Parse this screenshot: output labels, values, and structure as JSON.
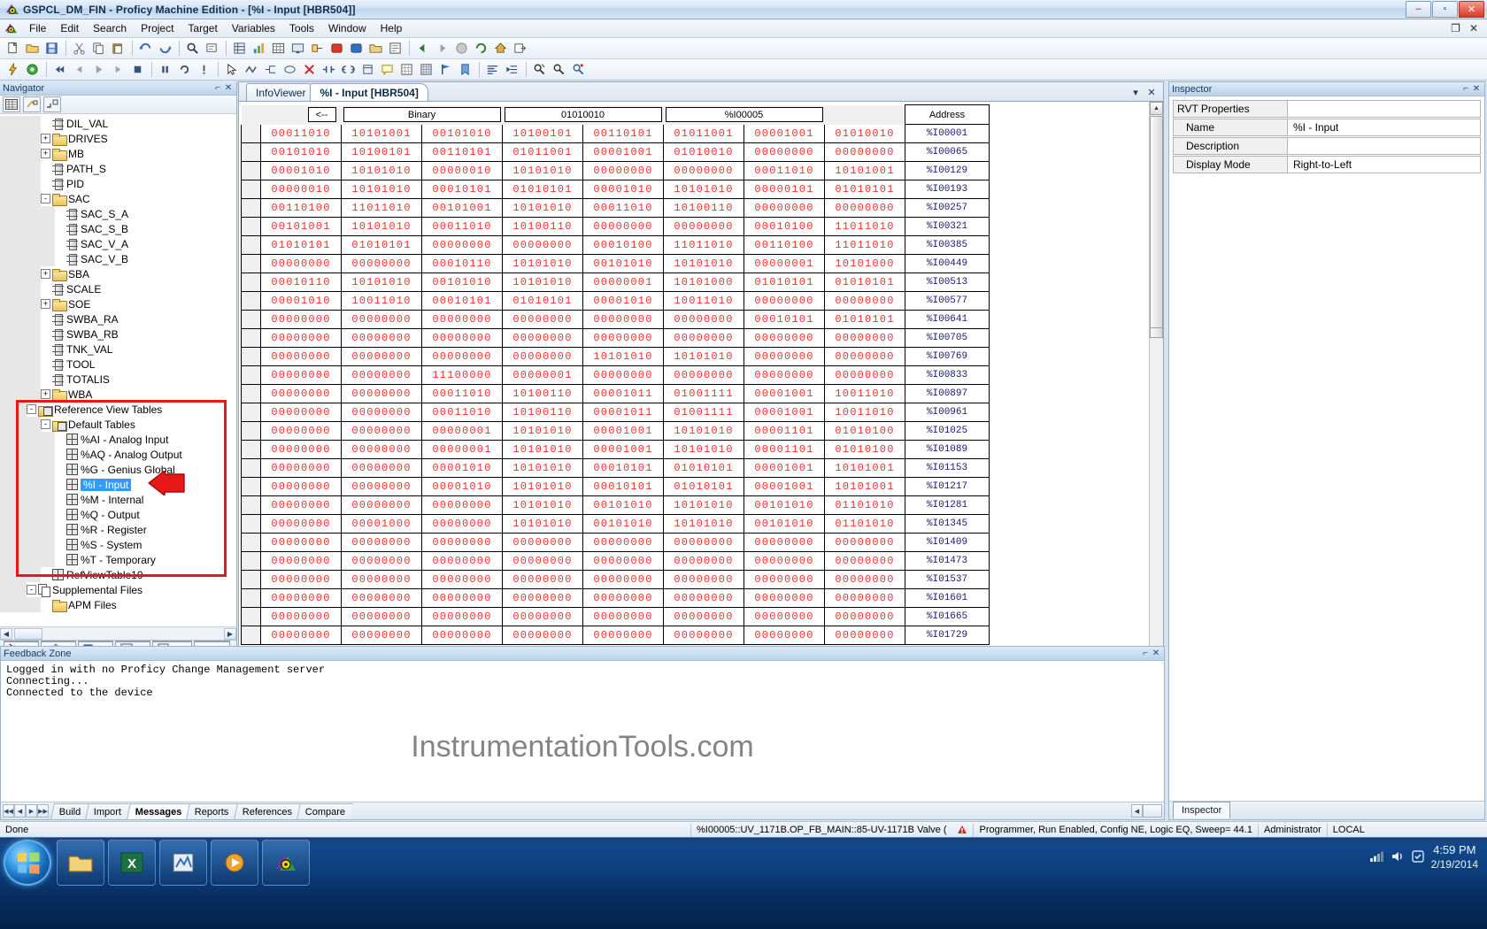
{
  "window": {
    "title": "GSPCL_DM_FIN - Proficy Machine Edition - [%I - Input [HBR504]]",
    "minimize": "–",
    "maximize": "▫",
    "close": "✕",
    "inner_restore": "❐",
    "inner_close": "✕"
  },
  "menu": [
    {
      "label": "File"
    },
    {
      "label": "Edit"
    },
    {
      "label": "Search"
    },
    {
      "label": "Project"
    },
    {
      "label": "Target"
    },
    {
      "label": "Variables"
    },
    {
      "label": "Tools"
    },
    {
      "label": "Window"
    },
    {
      "label": "Help"
    }
  ],
  "navigator": {
    "caption": "Navigator",
    "pin": "⌐",
    "close": "✕",
    "toolbar_icons": [
      "grid-view-icon",
      "expand-partial-icon",
      "collapse-icon"
    ],
    "tree": [
      {
        "indent": 3,
        "toggle": "",
        "icon": "block-icon",
        "label": "DIL_VAL"
      },
      {
        "indent": 3,
        "toggle": "+",
        "icon": "folder-icon",
        "label": "DRIVES"
      },
      {
        "indent": 3,
        "toggle": "+",
        "icon": "folder-icon",
        "label": "MB"
      },
      {
        "indent": 3,
        "toggle": "",
        "icon": "block-icon",
        "label": "PATH_S"
      },
      {
        "indent": 3,
        "toggle": "",
        "icon": "block-icon",
        "label": "PID"
      },
      {
        "indent": 3,
        "toggle": "-",
        "icon": "folder-icon",
        "label": "SAC"
      },
      {
        "indent": 4,
        "toggle": "",
        "icon": "block-icon",
        "label": "SAC_S_A"
      },
      {
        "indent": 4,
        "toggle": "",
        "icon": "block-icon",
        "label": "SAC_S_B"
      },
      {
        "indent": 4,
        "toggle": "",
        "icon": "block-icon",
        "label": "SAC_V_A"
      },
      {
        "indent": 4,
        "toggle": "",
        "icon": "block-icon",
        "label": "SAC_V_B"
      },
      {
        "indent": 3,
        "toggle": "+",
        "icon": "folder-icon",
        "label": "SBA"
      },
      {
        "indent": 3,
        "toggle": "",
        "icon": "block-icon",
        "label": "SCALE"
      },
      {
        "indent": 3,
        "toggle": "+",
        "icon": "folder-icon",
        "label": "SOE"
      },
      {
        "indent": 3,
        "toggle": "",
        "icon": "block-icon",
        "label": "SWBA_RA"
      },
      {
        "indent": 3,
        "toggle": "",
        "icon": "block-icon",
        "label": "SWBA_RB"
      },
      {
        "indent": 3,
        "toggle": "",
        "icon": "block-icon",
        "label": "TNK_VAL"
      },
      {
        "indent": 3,
        "toggle": "",
        "icon": "block-icon",
        "label": "TOOL"
      },
      {
        "indent": 3,
        "toggle": "",
        "icon": "block-icon",
        "label": "TOTALIS"
      },
      {
        "indent": 3,
        "toggle": "+",
        "icon": "folder-icon",
        "label": "WBA"
      },
      {
        "indent": 2,
        "toggle": "-",
        "icon": "table-folder-icon",
        "label": "Reference View Tables"
      },
      {
        "indent": 3,
        "toggle": "-",
        "icon": "table-folder-icon",
        "label": "Default Tables"
      },
      {
        "indent": 4,
        "toggle": "",
        "icon": "ref-table-icon",
        "label": "%AI - Analog Input"
      },
      {
        "indent": 4,
        "toggle": "",
        "icon": "ref-table-icon",
        "label": "%AQ - Analog Output"
      },
      {
        "indent": 4,
        "toggle": "",
        "icon": "ref-table-icon",
        "label": "%G - Genius Global"
      },
      {
        "indent": 4,
        "toggle": "",
        "icon": "ref-table-icon",
        "label": "%I - Input",
        "selected": true
      },
      {
        "indent": 4,
        "toggle": "",
        "icon": "ref-table-icon",
        "label": "%M - Internal"
      },
      {
        "indent": 4,
        "toggle": "",
        "icon": "ref-table-icon",
        "label": "%Q - Output"
      },
      {
        "indent": 4,
        "toggle": "",
        "icon": "ref-table-icon",
        "label": "%R - Register"
      },
      {
        "indent": 4,
        "toggle": "",
        "icon": "ref-table-icon",
        "label": "%S - System"
      },
      {
        "indent": 4,
        "toggle": "",
        "icon": "ref-table-icon",
        "label": "%T - Temporary"
      },
      {
        "indent": 3,
        "toggle": "",
        "icon": "ref-table-icon",
        "label": "RefViewTable10"
      },
      {
        "indent": 2,
        "toggle": "-",
        "icon": "copy-icon",
        "label": "Supplemental Files"
      },
      {
        "indent": 3,
        "toggle": "",
        "icon": "folder-icon",
        "label": "APM Files"
      }
    ],
    "bottom_tabs": [
      {
        "icon": "navigator-tab-icon",
        "label": "..."
      },
      {
        "icon": "pencil-tab-icon",
        "label": "..."
      },
      {
        "icon": "manager-tab-icon",
        "label": "..."
      },
      {
        "icon": "options-tab-icon",
        "label": "...",
        "active": true
      },
      {
        "icon": "variables-tab-icon",
        "label": "V..."
      },
      {
        "icon": "help-tab-icon",
        "label": "I..."
      }
    ]
  },
  "document": {
    "tabs": [
      {
        "label": "InfoViewer",
        "active": false
      },
      {
        "label": "%I - Input [HBR504]",
        "active": true
      }
    ],
    "controls": {
      "dropdown": "▾",
      "close": "✕"
    },
    "grid": {
      "headers": [
        "<--",
        "Binary",
        "01010010",
        "%I00005",
        "Address"
      ],
      "rows": [
        {
          "values": [
            "00011010",
            "10101001",
            "00101010",
            "10100101",
            "00110101",
            "01011001",
            "00001001",
            "01010010"
          ],
          "address": "%I00001"
        },
        {
          "values": [
            "00101010",
            "10100101",
            "00110101",
            "01011001",
            "00001001",
            "01010010",
            "00000000",
            "00000000"
          ],
          "address": "%I00065"
        },
        {
          "values": [
            "00001010",
            "10101010",
            "00000010",
            "10101010",
            "00000000",
            "00000000",
            "00011010",
            "10101001"
          ],
          "address": "%I00129"
        },
        {
          "values": [
            "00000010",
            "10101010",
            "00010101",
            "01010101",
            "00001010",
            "10101010",
            "00000101",
            "01010101"
          ],
          "address": "%I00193"
        },
        {
          "values": [
            "00110100",
            "11011010",
            "00101001",
            "10101010",
            "00011010",
            "10100110",
            "00000000",
            "00000000"
          ],
          "address": "%I00257"
        },
        {
          "values": [
            "00101001",
            "10101010",
            "00011010",
            "10100110",
            "00000000",
            "00000000",
            "00010100",
            "11011010"
          ],
          "address": "%I00321"
        },
        {
          "values": [
            "01010101",
            "01010101",
            "00000000",
            "00000000",
            "00010100",
            "11011010",
            "00110100",
            "11011010"
          ],
          "address": "%I00385"
        },
        {
          "values": [
            "00000000",
            "00000000",
            "00010110",
            "10101010",
            "00101010",
            "10101010",
            "00000001",
            "10101000"
          ],
          "address": "%I00449"
        },
        {
          "values": [
            "00010110",
            "10101010",
            "00101010",
            "10101010",
            "00000001",
            "10101000",
            "01010101",
            "01010101"
          ],
          "address": "%I00513"
        },
        {
          "values": [
            "00001010",
            "10011010",
            "00010101",
            "01010101",
            "00001010",
            "10011010",
            "00000000",
            "00000000"
          ],
          "address": "%I00577"
        },
        {
          "values": [
            "00000000",
            "00000000",
            "00000000",
            "00000000",
            "00000000",
            "00000000",
            "00010101",
            "01010101"
          ],
          "address": "%I00641"
        },
        {
          "values": [
            "00000000",
            "00000000",
            "00000000",
            "00000000",
            "00000000",
            "00000000",
            "00000000",
            "00000000"
          ],
          "address": "%I00705"
        },
        {
          "values": [
            "00000000",
            "00000000",
            "00000000",
            "00000000",
            "10101010",
            "10101010",
            "00000000",
            "00000000"
          ],
          "address": "%I00769"
        },
        {
          "values": [
            "00000000",
            "00000000",
            "11100000",
            "00000001",
            "00000000",
            "00000000",
            "00000000",
            "00000000"
          ],
          "address": "%I00833"
        },
        {
          "values": [
            "00000000",
            "00000000",
            "00011010",
            "10100110",
            "00001011",
            "01001111",
            "00001001",
            "10011010"
          ],
          "address": "%I00897"
        },
        {
          "values": [
            "00000000",
            "00000000",
            "00011010",
            "10100110",
            "00001011",
            "01001111",
            "00001001",
            "10011010"
          ],
          "address": "%I00961"
        },
        {
          "values": [
            "00000000",
            "00000000",
            "00000001",
            "10101010",
            "00001001",
            "10101010",
            "00001101",
            "01010100"
          ],
          "address": "%I01025"
        },
        {
          "values": [
            "00000000",
            "00000000",
            "00000001",
            "10101010",
            "00001001",
            "10101010",
            "00001101",
            "01010100"
          ],
          "address": "%I01089"
        },
        {
          "values": [
            "00000000",
            "00000000",
            "00001010",
            "10101010",
            "00010101",
            "01010101",
            "00001001",
            "10101001"
          ],
          "address": "%I01153"
        },
        {
          "values": [
            "00000000",
            "00000000",
            "00001010",
            "10101010",
            "00010101",
            "01010101",
            "00001001",
            "10101001"
          ],
          "address": "%I01217"
        },
        {
          "values": [
            "00000000",
            "00000000",
            "00000000",
            "10101010",
            "00101010",
            "10101010",
            "00101010",
            "01101010"
          ],
          "address": "%I01281"
        },
        {
          "values": [
            "00000000",
            "00001000",
            "00000000",
            "10101010",
            "00101010",
            "10101010",
            "00101010",
            "01101010"
          ],
          "address": "%I01345"
        },
        {
          "values": [
            "00000000",
            "00000000",
            "00000000",
            "00000000",
            "00000000",
            "00000000",
            "00000000",
            "00000000"
          ],
          "address": "%I01409"
        },
        {
          "values": [
            "00000000",
            "00000000",
            "00000000",
            "00000000",
            "00000000",
            "00000000",
            "00000000",
            "00000000"
          ],
          "address": "%I01473"
        },
        {
          "values": [
            "00000000",
            "00000000",
            "00000000",
            "00000000",
            "00000000",
            "00000000",
            "00000000",
            "00000000"
          ],
          "address": "%I01537"
        },
        {
          "values": [
            "00000000",
            "00000000",
            "00000000",
            "00000000",
            "00000000",
            "00000000",
            "00000000",
            "00000000"
          ],
          "address": "%I01601"
        },
        {
          "values": [
            "00000000",
            "00000000",
            "00000000",
            "00000000",
            "00000000",
            "00000000",
            "00000000",
            "00000000"
          ],
          "address": "%I01665"
        },
        {
          "values": [
            "00000000",
            "00000000",
            "00000000",
            "00000000",
            "00000000",
            "00000000",
            "00000000",
            "00000000"
          ],
          "address": "%I01729"
        }
      ]
    }
  },
  "inspector": {
    "caption": "Inspector",
    "pin": "⌐",
    "close": "✕",
    "properties": [
      {
        "key": "RVT Properties",
        "value": "",
        "section": true
      },
      {
        "key": "Name",
        "value": "%I - Input"
      },
      {
        "key": "Description",
        "value": ""
      },
      {
        "key": "Display Mode",
        "value": "Right-to-Left"
      }
    ],
    "bottom_tab": "Inspector"
  },
  "feedback": {
    "caption": "Feedback Zone",
    "pin": "⌐",
    "close": "✕",
    "lines": [
      "Logged in with no Proficy Change Management server",
      "Connecting...",
      "Connected to the device"
    ],
    "watermark": "InstrumentationTools.com",
    "tabs": [
      {
        "label": "Build",
        "active": false
      },
      {
        "label": "Import",
        "active": false
      },
      {
        "label": "Messages",
        "active": true
      },
      {
        "label": "Reports",
        "active": false
      },
      {
        "label": "References",
        "active": false
      },
      {
        "label": "Compare",
        "active": false
      }
    ],
    "nav_buttons": [
      "◀◀",
      "◀",
      "▶",
      "▶▶"
    ]
  },
  "statusbar": {
    "left": "Done",
    "segments": [
      "%I00005::UV_1171B.OP_FB_MAIN::85-UV-1171B Valve (",
      "Programmer, Run Enabled, Config NE, Logic EQ, Sweep= 44.1",
      "Administrator",
      "LOCAL"
    ]
  },
  "taskbar": {
    "items": [
      "explorer-icon",
      "excel-icon",
      "app-icon",
      "media-icon",
      "proficy-icon"
    ],
    "tray": {
      "time": "4:59 PM",
      "date": "2/19/2014",
      "icons": [
        "network-icon",
        "volume-icon",
        "action-center-icon"
      ]
    }
  },
  "annotation": {
    "box_color": "#e81818",
    "arrow_color": "#e81818"
  }
}
